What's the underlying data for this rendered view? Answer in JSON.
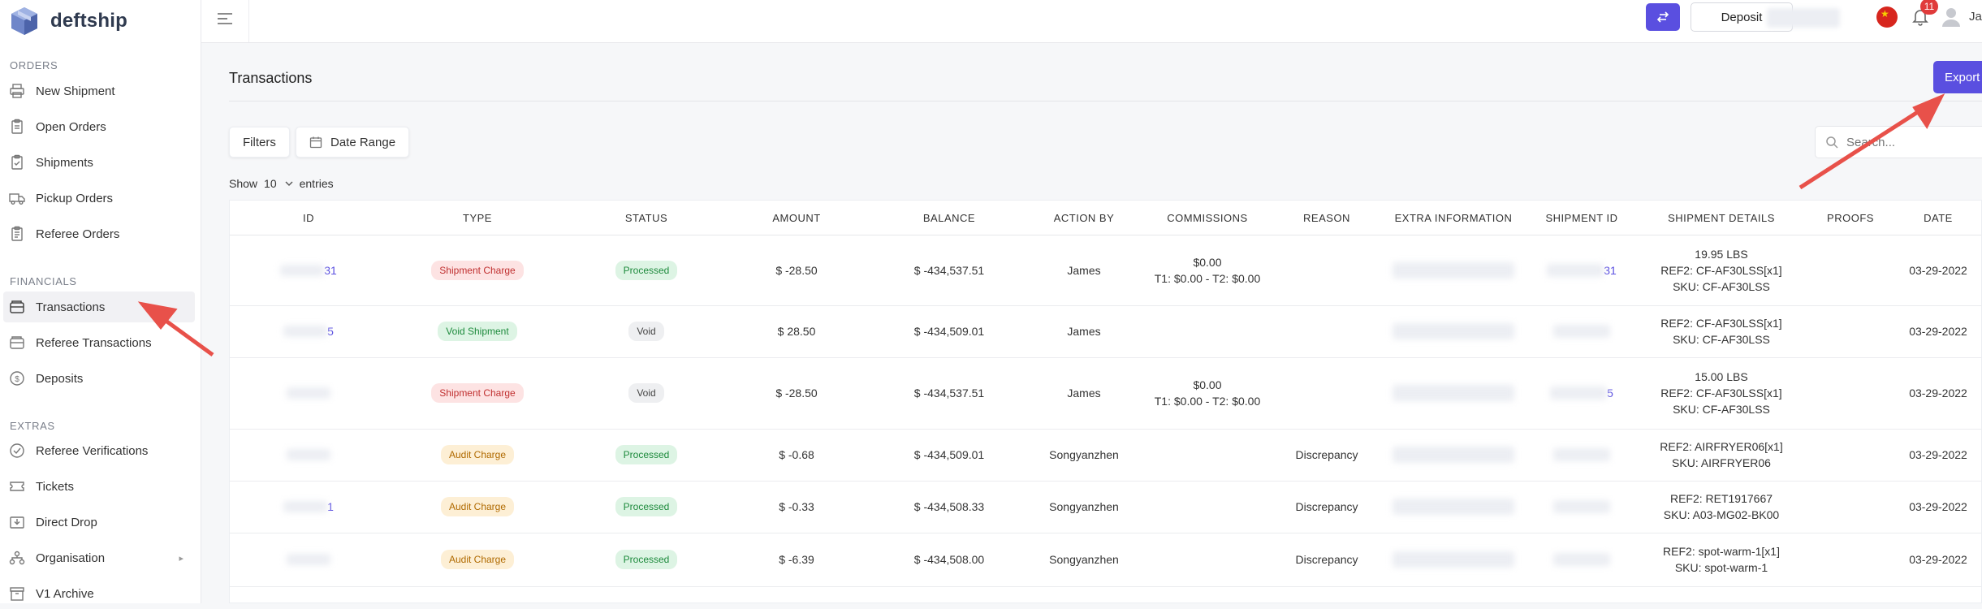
{
  "brand": {
    "name": "deftship"
  },
  "sidebar": {
    "sections": [
      {
        "title": "ORDERS"
      },
      {
        "title": "FINANCIALS"
      },
      {
        "title": "EXTRAS"
      }
    ],
    "items": [
      {
        "label": "New Shipment",
        "icon": "printer-icon"
      },
      {
        "label": "Open Orders",
        "icon": "clipboard-icon"
      },
      {
        "label": "Shipments",
        "icon": "clipboard-check-icon"
      },
      {
        "label": "Pickup Orders",
        "icon": "truck-icon"
      },
      {
        "label": "Referee Orders",
        "icon": "clipboard-list-icon"
      },
      {
        "label": "Transactions",
        "icon": "wallet-icon",
        "active": true
      },
      {
        "label": "Referee Transactions",
        "icon": "wallet-icon"
      },
      {
        "label": "Deposits",
        "icon": "dollar-circle-icon"
      },
      {
        "label": "Referee Verifications",
        "icon": "check-circle-icon"
      },
      {
        "label": "Tickets",
        "icon": "ticket-icon"
      },
      {
        "label": "Direct Drop",
        "icon": "inbox-download-icon"
      },
      {
        "label": "Organisation",
        "icon": "org-chart-icon"
      },
      {
        "label": "V1 Archive",
        "icon": "archive-icon"
      }
    ]
  },
  "topbar": {
    "deposit_label": "Deposit",
    "notifications_count": "11",
    "user_name": "Ja",
    "accent": "#5a4fe0"
  },
  "main": {
    "title": "Transactions",
    "export_label": "Export",
    "filters_label": "Filters",
    "date_range_label": "Date Range",
    "search_placeholder": "Search...",
    "show_label": "Show",
    "show_value": "10",
    "entries_label": "entries"
  },
  "table": {
    "headers": [
      "ID",
      "TYPE",
      "STATUS",
      "AMOUNT",
      "BALANCE",
      "ACTION BY",
      "COMMISSIONS",
      "REASON",
      "EXTRA INFORMATION",
      "SHIPMENT ID",
      "SHIPMENT DETAILS",
      "PROOFS",
      "DATE"
    ],
    "rows": [
      {
        "id": "31",
        "type": "Shipment Charge",
        "type_color": "red",
        "status": "Processed",
        "status_color": "green",
        "amount": "$ -28.50",
        "balance": "$ -434,537.51",
        "action_by": "James",
        "commissions": [
          "$0.00",
          "T1: $0.00 - T2: $0.00"
        ],
        "reason": "",
        "shipment_id": "31",
        "details": [
          "19.95 LBS",
          "REF2: CF-AF30LSS[x1]",
          "SKU: CF-AF30LSS"
        ],
        "date": "03-29-2022"
      },
      {
        "id": "5",
        "type": "Void Shipment",
        "type_color": "green",
        "status": "Void",
        "status_color": "grey",
        "amount": "$ 28.50",
        "balance": "$ -434,509.01",
        "action_by": "James",
        "commissions": [],
        "reason": "",
        "shipment_id": "",
        "details": [
          "REF2: CF-AF30LSS[x1]",
          "SKU: CF-AF30LSS"
        ],
        "date": "03-29-2022"
      },
      {
        "id": "",
        "type": "Shipment Charge",
        "type_color": "red",
        "status": "Void",
        "status_color": "grey",
        "amount": "$ -28.50",
        "balance": "$ -434,537.51",
        "action_by": "James",
        "commissions": [
          "$0.00",
          "T1: $0.00 - T2: $0.00"
        ],
        "reason": "",
        "shipment_id": "5",
        "details": [
          "15.00 LBS",
          "REF2: CF-AF30LSS[x1]",
          "SKU: CF-AF30LSS"
        ],
        "date": "03-29-2022"
      },
      {
        "id": "",
        "type": "Audit Charge",
        "type_color": "orange",
        "status": "Processed",
        "status_color": "green",
        "amount": "$ -0.68",
        "balance": "$ -434,509.01",
        "action_by": "Songyanzhen",
        "commissions": [],
        "reason": "Discrepancy",
        "shipment_id": "",
        "details": [
          "REF2: AIRFRYER06[x1]",
          "SKU: AIRFRYER06"
        ],
        "date": "03-29-2022"
      },
      {
        "id": "1",
        "type": "Audit Charge",
        "type_color": "orange",
        "status": "Processed",
        "status_color": "green",
        "amount": "$ -0.33",
        "balance": "$ -434,508.33",
        "action_by": "Songyanzhen",
        "commissions": [],
        "reason": "Discrepancy",
        "shipment_id": "",
        "details": [
          "REF2: RET1917667",
          "SKU: A03-MG02-BK00"
        ],
        "date": "03-29-2022"
      },
      {
        "id": "",
        "type": "Audit Charge",
        "type_color": "orange",
        "status": "Processed",
        "status_color": "green",
        "amount": "$ -6.39",
        "balance": "$ -434,508.00",
        "action_by": "Songyanzhen",
        "commissions": [],
        "reason": "Discrepancy",
        "shipment_id": "",
        "details": [
          "REF2: spot-warm-1[x1]",
          "SKU: spot-warm-1"
        ],
        "date": "03-29-2022"
      }
    ]
  }
}
